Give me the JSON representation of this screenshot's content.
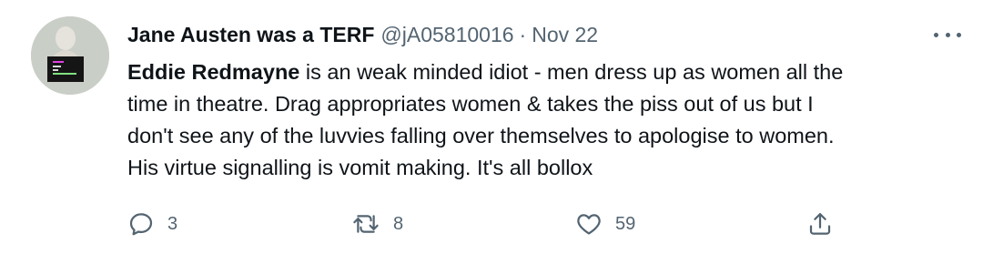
{
  "tweet": {
    "display_name": "Jane Austen was a TERF",
    "handle": "@jA05810016",
    "separator": "·",
    "date": "Nov 22",
    "body": {
      "mention": "Eddie Redmayne",
      "line1_rest": " is an weak minded idiot - men dress up as women all the",
      "line2": "time in theatre. Drag appropriates women & takes the piss out of us but I",
      "line3": "don't see any of the luvvies falling over themselves to apologise to women.",
      "line4": "His virtue signalling is vomit making. It's all bollox"
    },
    "actions": {
      "reply_count": "3",
      "retweet_count": "8",
      "like_count": "59"
    },
    "icons": {
      "reply": "reply-icon",
      "retweet": "retweet-icon",
      "like": "heart-icon",
      "share": "share-icon",
      "more": "more-options-icon"
    },
    "colors": {
      "text": "#0f1419",
      "secondary": "#536471",
      "background": "#ffffff"
    }
  }
}
